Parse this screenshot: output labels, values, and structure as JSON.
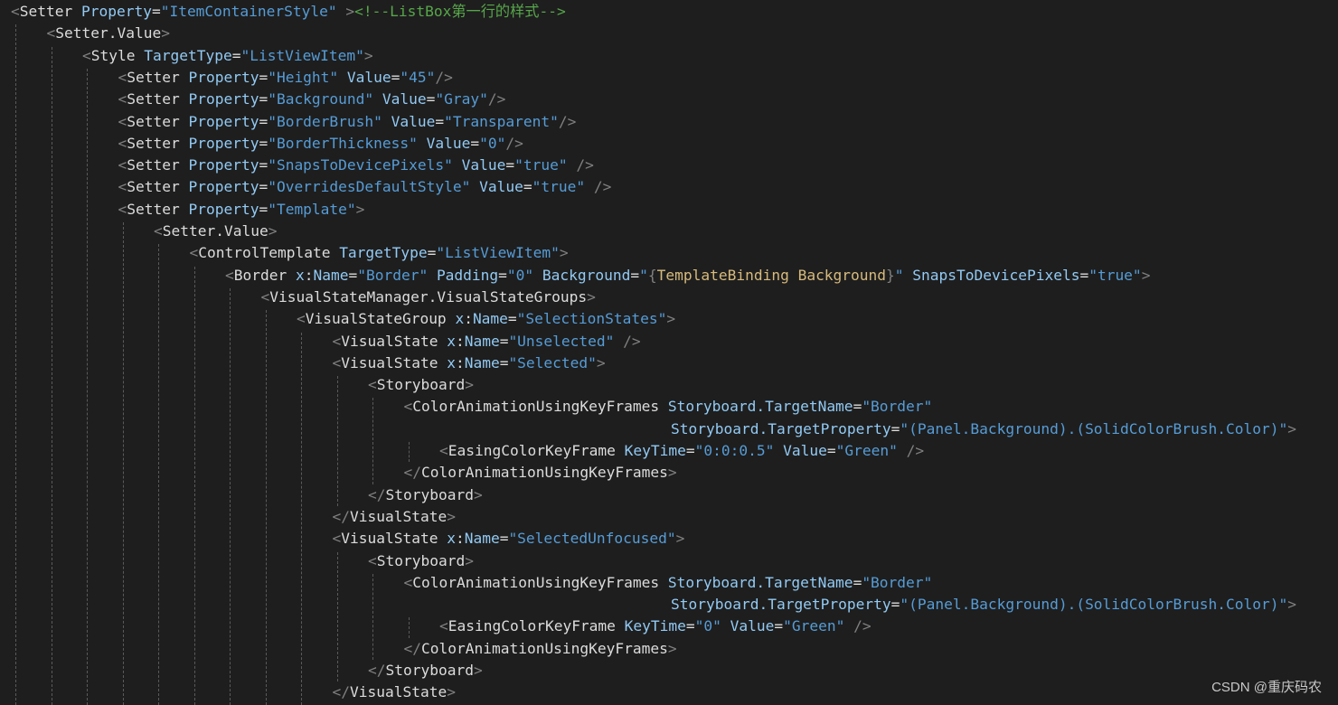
{
  "editor": {
    "language": "XAML",
    "theme_colors": {
      "background": "#1e1e1e",
      "punctuation": "#808080",
      "element": "#dcdcdc",
      "attribute": "#92caf4",
      "value": "#569cd6",
      "comment": "#57a64a",
      "markup_extension": "#d7ba7d"
    },
    "lines": [
      {
        "indent": 0,
        "tokens": [
          [
            "p",
            "<"
          ],
          [
            "e",
            "Setter"
          ],
          [
            "t",
            " "
          ],
          [
            "a",
            "Property"
          ],
          [
            "q",
            "="
          ],
          [
            "v",
            "\"ItemContainerStyle\""
          ],
          [
            "t",
            " "
          ],
          [
            "p",
            ">"
          ],
          [
            "c",
            "<!--ListBox第一行的样式-->"
          ]
        ]
      },
      {
        "indent": 1,
        "tokens": [
          [
            "p",
            "<"
          ],
          [
            "e",
            "Setter.Value"
          ],
          [
            "p",
            ">"
          ]
        ]
      },
      {
        "indent": 2,
        "tokens": [
          [
            "p",
            "<"
          ],
          [
            "e",
            "Style"
          ],
          [
            "t",
            " "
          ],
          [
            "a",
            "TargetType"
          ],
          [
            "q",
            "="
          ],
          [
            "v",
            "\"ListViewItem\""
          ],
          [
            "p",
            ">"
          ]
        ]
      },
      {
        "indent": 3,
        "tokens": [
          [
            "p",
            "<"
          ],
          [
            "e",
            "Setter"
          ],
          [
            "t",
            " "
          ],
          [
            "a",
            "Property"
          ],
          [
            "q",
            "="
          ],
          [
            "v",
            "\"Height\""
          ],
          [
            "t",
            " "
          ],
          [
            "a",
            "Value"
          ],
          [
            "q",
            "="
          ],
          [
            "v",
            "\"45\""
          ],
          [
            "p",
            "/>"
          ]
        ]
      },
      {
        "indent": 3,
        "tokens": [
          [
            "p",
            "<"
          ],
          [
            "e",
            "Setter"
          ],
          [
            "t",
            " "
          ],
          [
            "a",
            "Property"
          ],
          [
            "q",
            "="
          ],
          [
            "v",
            "\"Background\""
          ],
          [
            "t",
            " "
          ],
          [
            "a",
            "Value"
          ],
          [
            "q",
            "="
          ],
          [
            "v",
            "\"Gray\""
          ],
          [
            "p",
            "/>"
          ]
        ]
      },
      {
        "indent": 3,
        "tokens": [
          [
            "p",
            "<"
          ],
          [
            "e",
            "Setter"
          ],
          [
            "t",
            " "
          ],
          [
            "a",
            "Property"
          ],
          [
            "q",
            "="
          ],
          [
            "v",
            "\"BorderBrush\""
          ],
          [
            "t",
            " "
          ],
          [
            "a",
            "Value"
          ],
          [
            "q",
            "="
          ],
          [
            "v",
            "\"Transparent\""
          ],
          [
            "p",
            "/>"
          ]
        ]
      },
      {
        "indent": 3,
        "tokens": [
          [
            "p",
            "<"
          ],
          [
            "e",
            "Setter"
          ],
          [
            "t",
            " "
          ],
          [
            "a",
            "Property"
          ],
          [
            "q",
            "="
          ],
          [
            "v",
            "\"BorderThickness\""
          ],
          [
            "t",
            " "
          ],
          [
            "a",
            "Value"
          ],
          [
            "q",
            "="
          ],
          [
            "v",
            "\"0\""
          ],
          [
            "p",
            "/>"
          ]
        ]
      },
      {
        "indent": 3,
        "tokens": [
          [
            "p",
            "<"
          ],
          [
            "e",
            "Setter"
          ],
          [
            "t",
            " "
          ],
          [
            "a",
            "Property"
          ],
          [
            "q",
            "="
          ],
          [
            "v",
            "\"SnapsToDevicePixels\""
          ],
          [
            "t",
            " "
          ],
          [
            "a",
            "Value"
          ],
          [
            "q",
            "="
          ],
          [
            "v",
            "\"true\""
          ],
          [
            "t",
            " "
          ],
          [
            "p",
            "/>"
          ]
        ]
      },
      {
        "indent": 3,
        "tokens": [
          [
            "p",
            "<"
          ],
          [
            "e",
            "Setter"
          ],
          [
            "t",
            " "
          ],
          [
            "a",
            "Property"
          ],
          [
            "q",
            "="
          ],
          [
            "v",
            "\"OverridesDefaultStyle\""
          ],
          [
            "t",
            " "
          ],
          [
            "a",
            "Value"
          ],
          [
            "q",
            "="
          ],
          [
            "v",
            "\"true\""
          ],
          [
            "t",
            " "
          ],
          [
            "p",
            "/>"
          ]
        ]
      },
      {
        "indent": 3,
        "tokens": [
          [
            "p",
            "<"
          ],
          [
            "e",
            "Setter"
          ],
          [
            "t",
            " "
          ],
          [
            "a",
            "Property"
          ],
          [
            "q",
            "="
          ],
          [
            "v",
            "\"Template\""
          ],
          [
            "p",
            ">"
          ]
        ]
      },
      {
        "indent": 4,
        "tokens": [
          [
            "p",
            "<"
          ],
          [
            "e",
            "Setter.Value"
          ],
          [
            "p",
            ">"
          ]
        ]
      },
      {
        "indent": 5,
        "tokens": [
          [
            "p",
            "<"
          ],
          [
            "e",
            "ControlTemplate"
          ],
          [
            "t",
            " "
          ],
          [
            "a",
            "TargetType"
          ],
          [
            "q",
            "="
          ],
          [
            "v",
            "\"ListViewItem\""
          ],
          [
            "p",
            ">"
          ]
        ]
      },
      {
        "indent": 6,
        "tokens": [
          [
            "p",
            "<"
          ],
          [
            "e",
            "Border"
          ],
          [
            "t",
            " "
          ],
          [
            "a",
            "x"
          ],
          [
            "q",
            ":"
          ],
          [
            "a",
            "Name"
          ],
          [
            "q",
            "="
          ],
          [
            "v",
            "\"Border\""
          ],
          [
            "t",
            " "
          ],
          [
            "a",
            "Padding"
          ],
          [
            "q",
            "="
          ],
          [
            "v",
            "\"0\""
          ],
          [
            "t",
            " "
          ],
          [
            "a",
            "Background"
          ],
          [
            "q",
            "="
          ],
          [
            "v",
            "\""
          ],
          [
            "p",
            "{"
          ],
          [
            "x",
            "TemplateBinding Background"
          ],
          [
            "p",
            "}"
          ],
          [
            "v",
            "\""
          ],
          [
            "t",
            " "
          ],
          [
            "a",
            "SnapsToDevicePixels"
          ],
          [
            "q",
            "="
          ],
          [
            "v",
            "\"true\""
          ],
          [
            "p",
            ">"
          ]
        ]
      },
      {
        "indent": 7,
        "tokens": [
          [
            "p",
            "<"
          ],
          [
            "e",
            "VisualStateManager.VisualStateGroups"
          ],
          [
            "p",
            ">"
          ]
        ]
      },
      {
        "indent": 8,
        "tokens": [
          [
            "p",
            "<"
          ],
          [
            "e",
            "VisualStateGroup"
          ],
          [
            "t",
            " "
          ],
          [
            "a",
            "x"
          ],
          [
            "q",
            ":"
          ],
          [
            "a",
            "Name"
          ],
          [
            "q",
            "="
          ],
          [
            "v",
            "\"SelectionStates\""
          ],
          [
            "p",
            ">"
          ]
        ]
      },
      {
        "indent": 9,
        "tokens": [
          [
            "p",
            "<"
          ],
          [
            "e",
            "VisualState"
          ],
          [
            "t",
            " "
          ],
          [
            "a",
            "x"
          ],
          [
            "q",
            ":"
          ],
          [
            "a",
            "Name"
          ],
          [
            "q",
            "="
          ],
          [
            "v",
            "\"Unselected\""
          ],
          [
            "t",
            " "
          ],
          [
            "p",
            "/>"
          ]
        ]
      },
      {
        "indent": 9,
        "tokens": [
          [
            "p",
            "<"
          ],
          [
            "e",
            "VisualState"
          ],
          [
            "t",
            " "
          ],
          [
            "a",
            "x"
          ],
          [
            "q",
            ":"
          ],
          [
            "a",
            "Name"
          ],
          [
            "q",
            "="
          ],
          [
            "v",
            "\"Selected\""
          ],
          [
            "p",
            ">"
          ]
        ]
      },
      {
        "indent": 10,
        "tokens": [
          [
            "p",
            "<"
          ],
          [
            "e",
            "Storyboard"
          ],
          [
            "p",
            ">"
          ]
        ]
      },
      {
        "indent": 11,
        "tokens": [
          [
            "p",
            "<"
          ],
          [
            "e",
            "ColorAnimationUsingKeyFrames"
          ],
          [
            "t",
            " "
          ],
          [
            "a",
            "Storyboard.TargetName"
          ],
          [
            "q",
            "="
          ],
          [
            "v",
            "\"Border\""
          ]
        ]
      },
      {
        "indent": 11,
        "pad": 30,
        "tokens": [
          [
            "a",
            "Storyboard.TargetProperty"
          ],
          [
            "q",
            "="
          ],
          [
            "v",
            "\"(Panel.Background).(SolidColorBrush.Color)\""
          ],
          [
            "p",
            ">"
          ]
        ]
      },
      {
        "indent": 12,
        "tokens": [
          [
            "p",
            "<"
          ],
          [
            "e",
            "EasingColorKeyFrame"
          ],
          [
            "t",
            " "
          ],
          [
            "a",
            "KeyTime"
          ],
          [
            "q",
            "="
          ],
          [
            "v",
            "\"0:0:0.5\""
          ],
          [
            "t",
            " "
          ],
          [
            "a",
            "Value"
          ],
          [
            "q",
            "="
          ],
          [
            "v",
            "\"Green\""
          ],
          [
            "t",
            " "
          ],
          [
            "p",
            "/>"
          ]
        ]
      },
      {
        "indent": 11,
        "tokens": [
          [
            "p",
            "</"
          ],
          [
            "e",
            "ColorAnimationUsingKeyFrames"
          ],
          [
            "p",
            ">"
          ]
        ]
      },
      {
        "indent": 10,
        "tokens": [
          [
            "p",
            "</"
          ],
          [
            "e",
            "Storyboard"
          ],
          [
            "p",
            ">"
          ]
        ]
      },
      {
        "indent": 9,
        "tokens": [
          [
            "p",
            "</"
          ],
          [
            "e",
            "VisualState"
          ],
          [
            "p",
            ">"
          ]
        ]
      },
      {
        "indent": 9,
        "tokens": [
          [
            "p",
            "<"
          ],
          [
            "e",
            "VisualState"
          ],
          [
            "t",
            " "
          ],
          [
            "a",
            "x"
          ],
          [
            "q",
            ":"
          ],
          [
            "a",
            "Name"
          ],
          [
            "q",
            "="
          ],
          [
            "v",
            "\"SelectedUnfocused\""
          ],
          [
            "p",
            ">"
          ]
        ]
      },
      {
        "indent": 10,
        "tokens": [
          [
            "p",
            "<"
          ],
          [
            "e",
            "Storyboard"
          ],
          [
            "p",
            ">"
          ]
        ]
      },
      {
        "indent": 11,
        "tokens": [
          [
            "p",
            "<"
          ],
          [
            "e",
            "ColorAnimationUsingKeyFrames"
          ],
          [
            "t",
            " "
          ],
          [
            "a",
            "Storyboard.TargetName"
          ],
          [
            "q",
            "="
          ],
          [
            "v",
            "\"Border\""
          ]
        ]
      },
      {
        "indent": 11,
        "pad": 30,
        "tokens": [
          [
            "a",
            "Storyboard.TargetProperty"
          ],
          [
            "q",
            "="
          ],
          [
            "v",
            "\"(Panel.Background).(SolidColorBrush.Color)\""
          ],
          [
            "p",
            ">"
          ]
        ]
      },
      {
        "indent": 12,
        "tokens": [
          [
            "p",
            "<"
          ],
          [
            "e",
            "EasingColorKeyFrame"
          ],
          [
            "t",
            " "
          ],
          [
            "a",
            "KeyTime"
          ],
          [
            "q",
            "="
          ],
          [
            "v",
            "\"0\""
          ],
          [
            "t",
            " "
          ],
          [
            "a",
            "Value"
          ],
          [
            "q",
            "="
          ],
          [
            "v",
            "\"Green\""
          ],
          [
            "t",
            " "
          ],
          [
            "p",
            "/>"
          ]
        ]
      },
      {
        "indent": 11,
        "tokens": [
          [
            "p",
            "</"
          ],
          [
            "e",
            "ColorAnimationUsingKeyFrames"
          ],
          [
            "p",
            ">"
          ]
        ]
      },
      {
        "indent": 10,
        "tokens": [
          [
            "p",
            "</"
          ],
          [
            "e",
            "Storyboard"
          ],
          [
            "p",
            ">"
          ]
        ]
      },
      {
        "indent": 9,
        "tokens": [
          [
            "p",
            "</"
          ],
          [
            "e",
            "VisualState"
          ],
          [
            "p",
            ">"
          ]
        ]
      }
    ]
  },
  "watermark": "CSDN @重庆码农"
}
